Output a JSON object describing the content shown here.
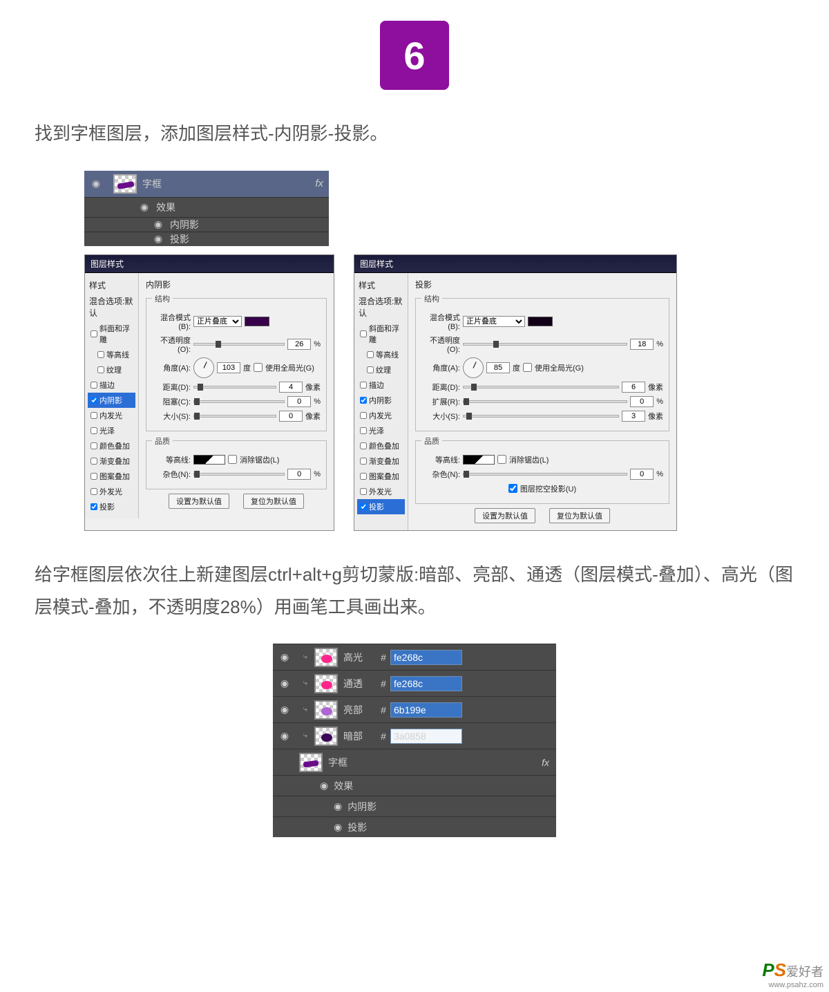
{
  "step": "6",
  "para1": "找到字框图层，添加图层样式-内阴影-投影。",
  "layersMini": {
    "layerName": "字框",
    "fx": "fx",
    "effects": "效果",
    "sub1": "内阴影",
    "sub2": "投影",
    "eye": "◉"
  },
  "dlg": {
    "title": "图层样式",
    "side": {
      "head": "样式",
      "blendDefault": "混合选项:默认",
      "bevel": "斜面和浮雕",
      "contourSub": "等高线",
      "textureSub": "纹理",
      "stroke": "描边",
      "innerShadow": "内阴影",
      "innerGlow": "内发光",
      "satin": "光泽",
      "colorOverlay": "颜色叠加",
      "gradOverlay": "渐变叠加",
      "patternOverlay": "图案叠加",
      "outerGlow": "外发光",
      "dropShadow": "投影"
    },
    "left": {
      "mainTitle": "内阴影",
      "struct": "结构",
      "blendMode": "混合模式(B):",
      "blendVal": "正片叠底",
      "opacity": "不透明度(O):",
      "opacityVal": "26",
      "pct": "%",
      "angle": "角度(A):",
      "angleVal": "103",
      "deg": "度",
      "globalLight": "使用全局光(G)",
      "distance": "距离(D):",
      "distanceVal": "4",
      "px": "像素",
      "choke": "阻塞(C):",
      "chokeVal": "0",
      "size": "大小(S):",
      "sizeVal": "0",
      "quality": "品质",
      "contour": "等高线:",
      "anti": "消除锯齿(L)",
      "noise": "杂色(N):",
      "noiseVal": "0",
      "btnDefault": "设置为默认值",
      "btnReset": "复位为默认值"
    },
    "right": {
      "mainTitle": "投影",
      "struct": "结构",
      "blendMode": "混合模式(B):",
      "blendVal": "正片叠底",
      "opacity": "不透明度(O):",
      "opacityVal": "18",
      "pct": "%",
      "angle": "角度(A):",
      "angleVal": "85",
      "deg": "度",
      "globalLight": "使用全局光(G)",
      "distance": "距离(D):",
      "distanceVal": "6",
      "px": "像素",
      "spread": "扩展(R):",
      "spreadVal": "0",
      "size": "大小(S):",
      "sizeVal": "3",
      "quality": "品质",
      "contour": "等高线:",
      "anti": "消除锯齿(L)",
      "noise": "杂色(N):",
      "noiseVal": "0",
      "knockout": "图层挖空投影(U)",
      "btnDefault": "设置为默认值",
      "btnReset": "复位为默认值"
    }
  },
  "para2": "给字框图层依次往上新建图层ctrl+alt+g剪切蒙版:暗部、亮部、通透（图层模式-叠加）、高光（图层模式-叠加，不透明度28%）用画笔工具画出来。",
  "layersBig": {
    "eye": "◉",
    "clip": "⤷",
    "hash": "#",
    "rows": [
      {
        "name": "高光",
        "hex": "fe268c",
        "sel": true,
        "color": "#fe268c"
      },
      {
        "name": "通透",
        "hex": "fe268c",
        "sel": true,
        "color": "#fe268c"
      },
      {
        "name": "亮部",
        "hex": "6b199e",
        "sel": true,
        "color": "#ad66d3"
      },
      {
        "name": "暗部",
        "hex": "3a0858",
        "sel": false,
        "color": "#3a0858"
      }
    ],
    "layerName": "字框",
    "fx": "fx",
    "effects": "效果",
    "sub1": "内阴影",
    "sub2": "投影"
  },
  "watermark": {
    "p": "P",
    "s": "S",
    "cn": "爱好者",
    "url": "www.psahz.com"
  }
}
